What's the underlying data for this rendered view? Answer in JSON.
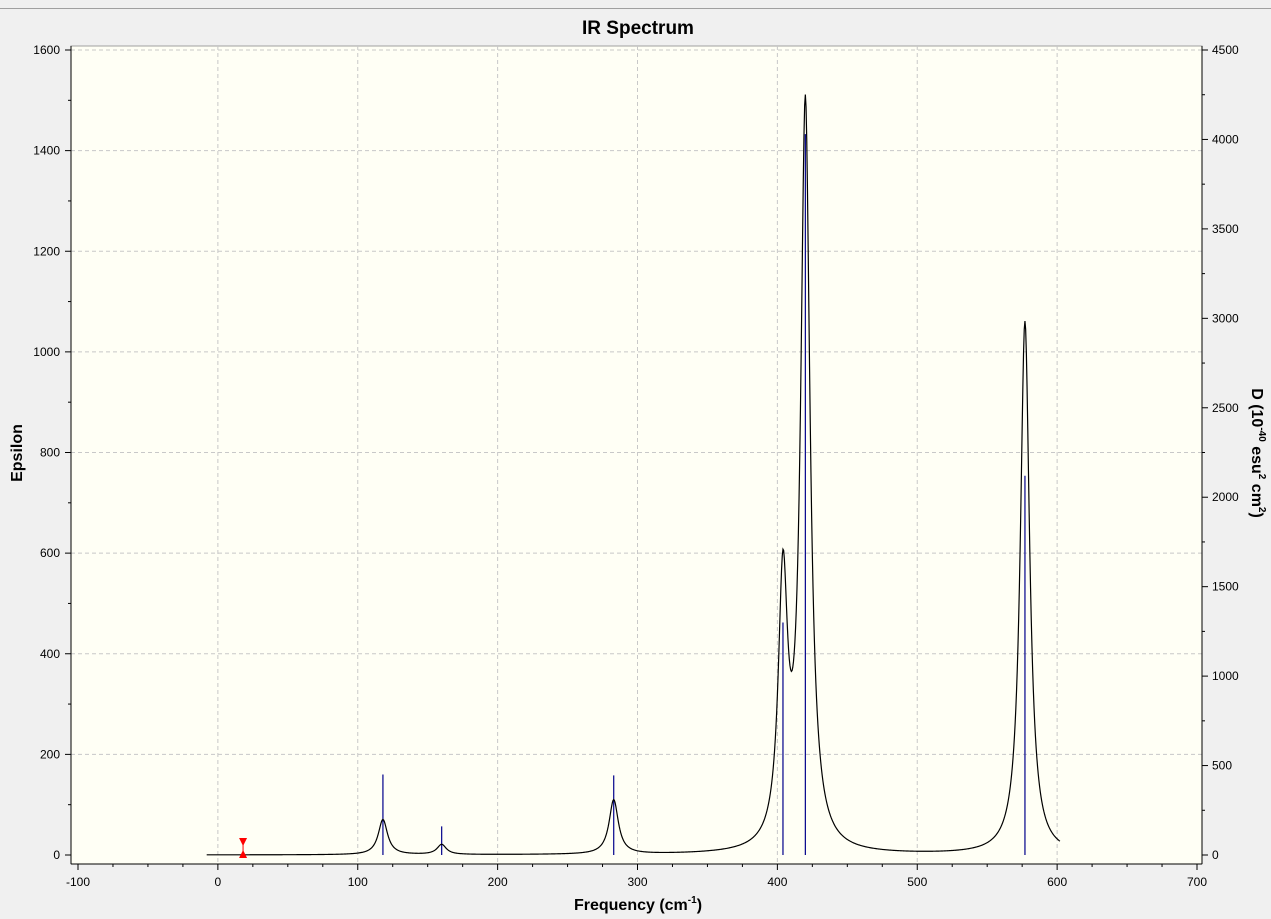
{
  "chart_data": {
    "type": "line",
    "title": "IR Spectrum",
    "xlabel": "Frequency (cm-1)",
    "xlabel_base": "Frequency (cm",
    "xlabel_sup": "-1",
    "xlabel_end": ")",
    "ylabel_left": "Epsilon",
    "ylabel_right_parts": [
      "D (10",
      "-40",
      " esu",
      "2",
      " cm",
      "2",
      ")"
    ],
    "xlim": [
      -100,
      700
    ],
    "ylim_left": [
      0,
      1600
    ],
    "ylim_right": [
      0,
      4500
    ],
    "x_ticks": [
      -100,
      0,
      100,
      200,
      300,
      400,
      500,
      600,
      700
    ],
    "y_left_ticks": [
      0,
      200,
      400,
      600,
      800,
      1000,
      1200,
      1400,
      1600
    ],
    "y_right_ticks": [
      0,
      500,
      1000,
      1500,
      2000,
      2500,
      3000,
      3500,
      4000,
      4500
    ],
    "grid": true,
    "plot_background": "#fffff5",
    "curve_color": "#000000",
    "stick_color": "#00008b",
    "marker_color": "#ff0000",
    "marker_x": 18,
    "curve_x_range": [
      -8,
      602
    ],
    "lorentzian_hwhm": 4,
    "peaks": [
      {
        "x": 118,
        "epsilon": 70
      },
      {
        "x": 160,
        "epsilon": 20
      },
      {
        "x": 283,
        "epsilon": 108
      },
      {
        "x": 404,
        "epsilon": 520
      },
      {
        "x": 420,
        "epsilon": 1480
      },
      {
        "x": 577,
        "epsilon": 1060
      }
    ],
    "sticks": [
      {
        "x": 118,
        "D": 450
      },
      {
        "x": 160,
        "D": 160
      },
      {
        "x": 283,
        "D": 445
      },
      {
        "x": 404,
        "D": 1300
      },
      {
        "x": 420,
        "D": 4030
      },
      {
        "x": 577,
        "D": 2120
      }
    ]
  }
}
